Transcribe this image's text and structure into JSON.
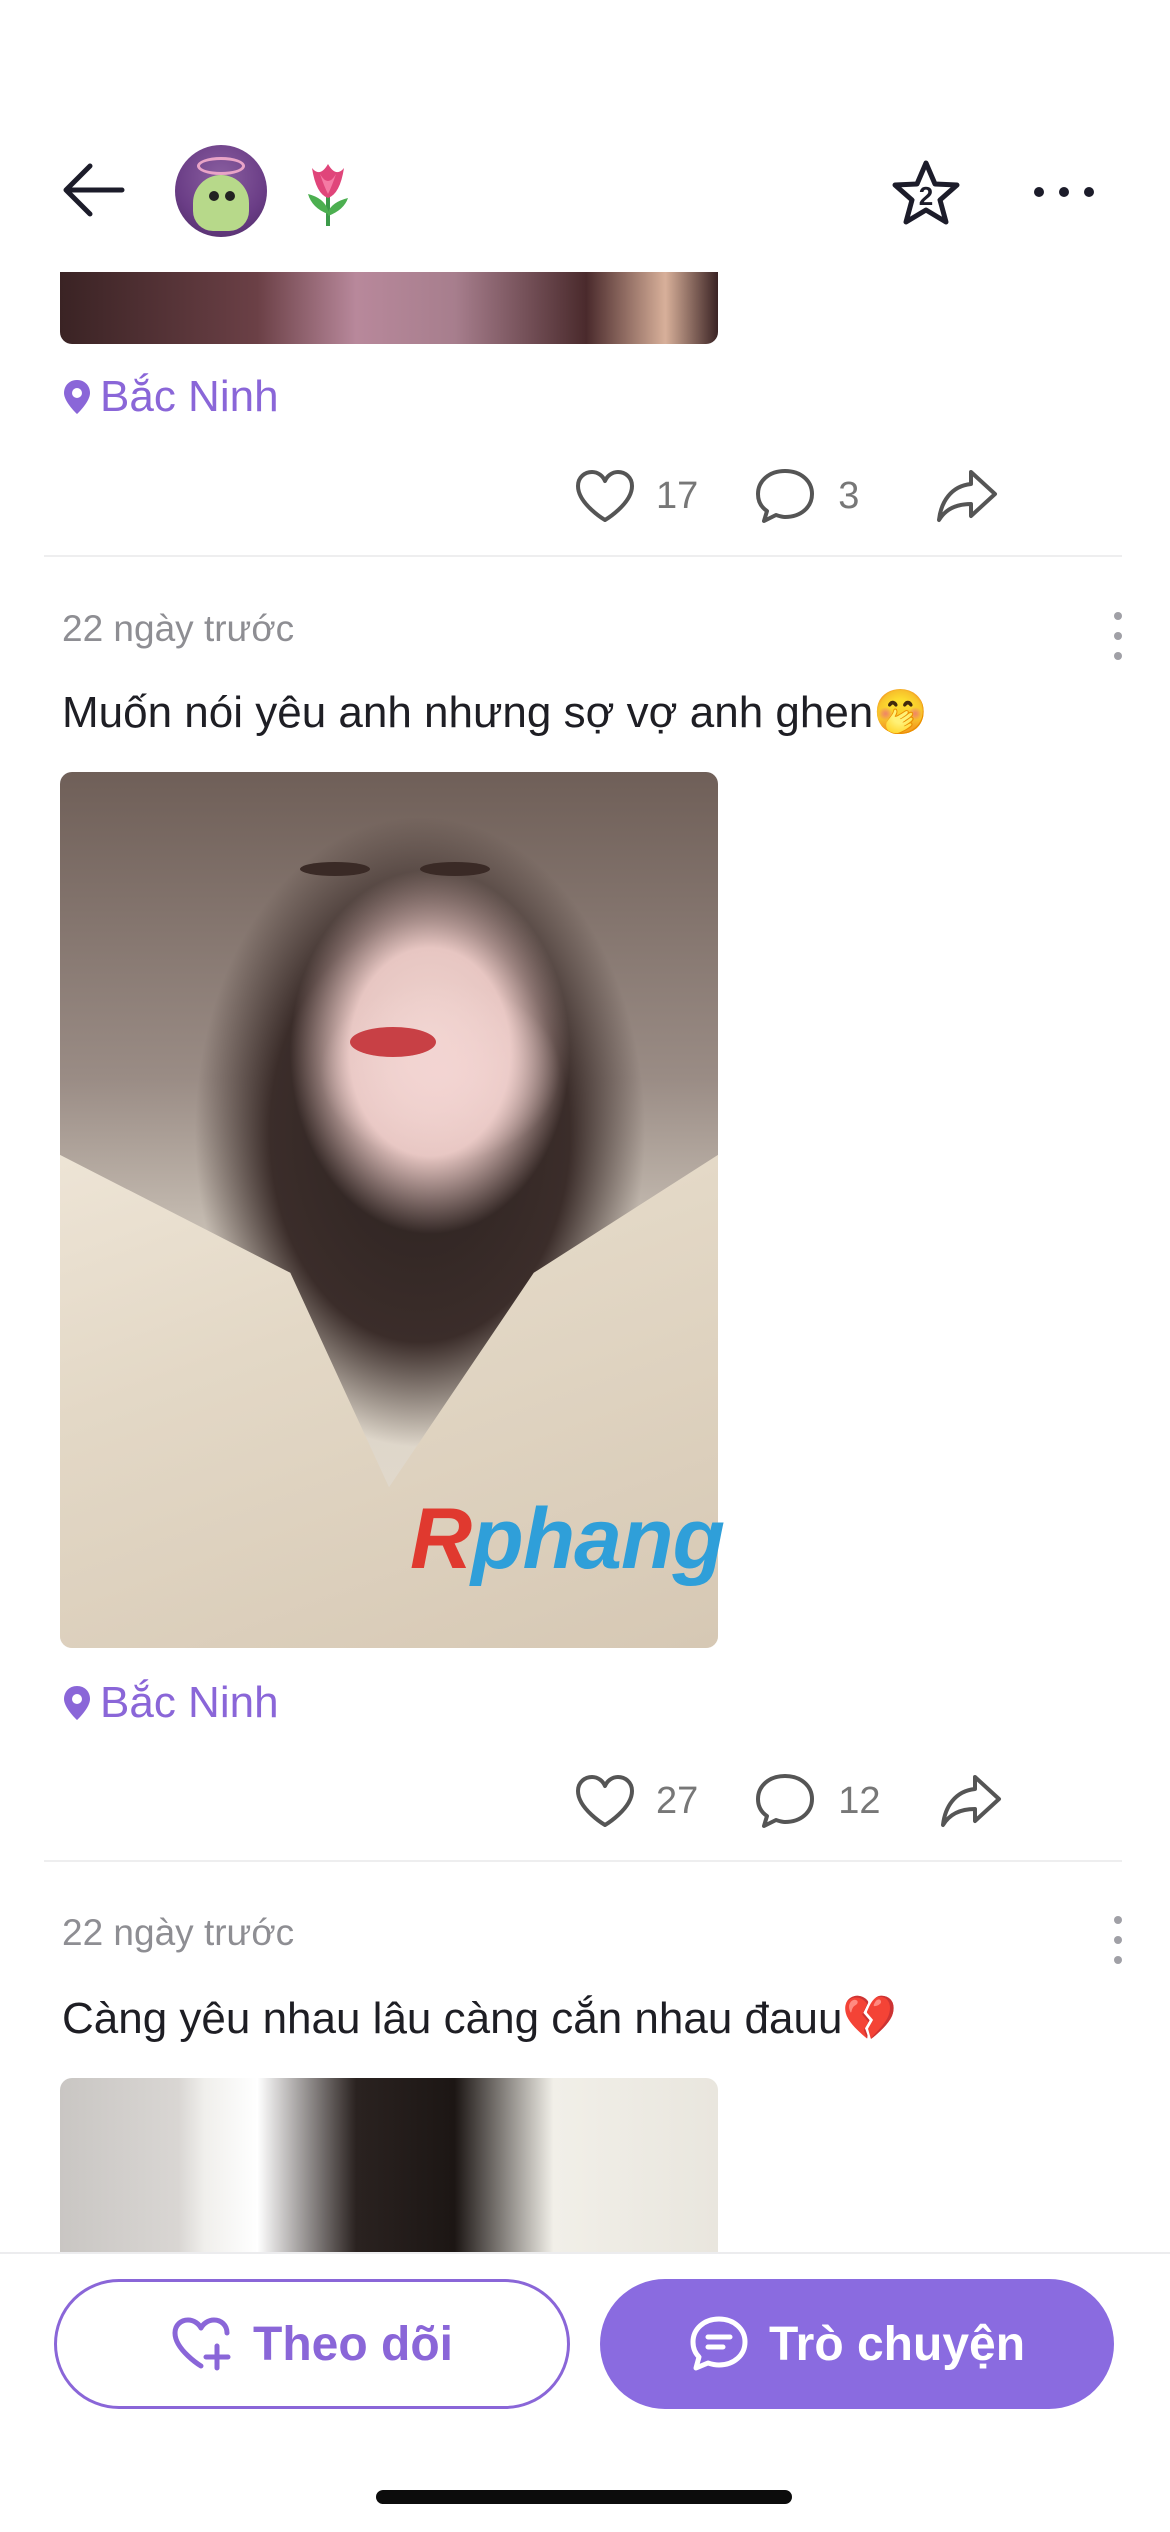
{
  "header": {
    "back_icon": "arrow-left-icon",
    "avatar": "profile-avatar",
    "flower_icon": "tulip-emoji",
    "star_badge": "2",
    "more_icon": "more-horizontal-icon"
  },
  "posts": [
    {
      "location": "Bắc Ninh",
      "likes": "17",
      "comments": "3"
    },
    {
      "time": "22 ngày trước",
      "text": "Muốn nói yêu anh nhưng sợ vợ anh ghen🤭",
      "watermark_r": "R",
      "watermark_rest": "phang",
      "location": "Bắc Ninh",
      "likes": "27",
      "comments": "12"
    },
    {
      "time": "22 ngày trước",
      "text": "Càng yêu nhau lâu càng cắn nhau đauu💔"
    }
  ],
  "bottom_bar": {
    "follow_label": "Theo dõi",
    "chat_label": "Trò chuyện"
  },
  "colors": {
    "accent": "#8a66d8",
    "chat_button": "#8a6be0"
  }
}
